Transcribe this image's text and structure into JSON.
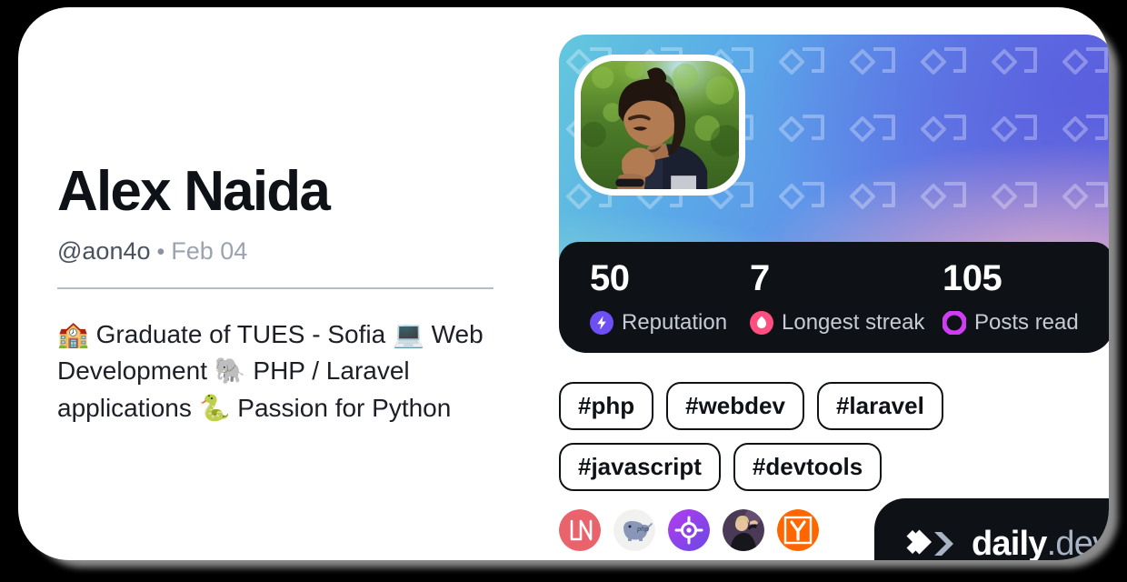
{
  "card": {
    "profile": {
      "name": "Alex Naida",
      "handle": "@aon4o",
      "separator": "•",
      "joined_date": "Feb 04",
      "bio": "🏫 Graduate of TUES - Sofia 💻 Web Development 🐘 PHP / Laravel applications 🐍 Passion for Python"
    },
    "cover": {
      "alt": "profile-cover-gradient",
      "pattern_icon": "daily-dev-chevron-watermark",
      "avatar_alt": "user-avatar-photo"
    },
    "stats": [
      {
        "value": "50",
        "label": "Reputation",
        "icon": "bolt-icon",
        "color": "#6E4FF6"
      },
      {
        "value": "7",
        "label": "Longest streak",
        "icon": "flame-icon",
        "color": "#FF4F81"
      },
      {
        "value": "105",
        "label": "Posts read",
        "icon": "ring-icon",
        "color": "#CE3DF3"
      }
    ],
    "tags": [
      "#php",
      "#webdev",
      "#laravel",
      "#javascript",
      "#devtools"
    ],
    "sources": [
      {
        "name": "laravel-news-source-icon",
        "label": "LN",
        "color": "#E8636B"
      },
      {
        "name": "php-elephant-source-icon",
        "label": "php",
        "color": "#F0F0F0"
      },
      {
        "name": "crosshair-source-icon",
        "label": "",
        "color": "#9B3FE8"
      },
      {
        "name": "photo-avatar-source-icon",
        "label": "",
        "color": "#4B3A55"
      },
      {
        "name": "hacker-news-source-icon",
        "label": "Y",
        "color": "#FF6600"
      }
    ],
    "brand": {
      "logo_icon": "daily-dev-logo-icon",
      "name": "daily",
      "tld": ".dev"
    },
    "colors": {
      "card_bg": "#FFFFFF",
      "page_bg": "#000000",
      "text_primary": "#0E1217",
      "text_secondary": "#4A5260",
      "text_muted": "#9BA3B0",
      "dark_panel": "#0E1217"
    }
  }
}
